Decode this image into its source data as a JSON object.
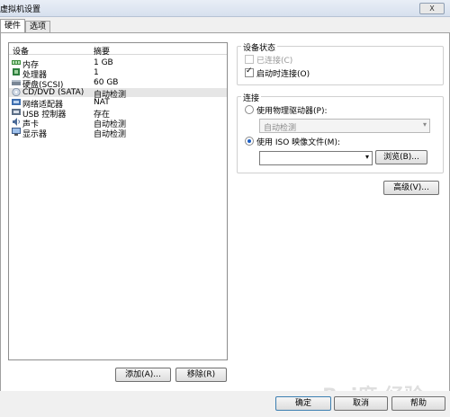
{
  "window": {
    "title": "虚拟机设置",
    "close_label": "X"
  },
  "tabs": [
    {
      "label": "硬件"
    },
    {
      "label": "选项"
    }
  ],
  "device_table": {
    "headers": {
      "device": "设备",
      "summary": "摘要"
    },
    "rows": [
      {
        "name": "内存",
        "summary": "1 GB",
        "icon": "memory-icon"
      },
      {
        "name": "处理器",
        "summary": "1",
        "icon": "cpu-icon"
      },
      {
        "name": "硬盘(SCSI)",
        "summary": "60 GB",
        "icon": "harddisk-icon"
      },
      {
        "name": "CD/DVD (SATA)",
        "summary": "自动检测",
        "icon": "cdrom-icon"
      },
      {
        "name": "网络适配器",
        "summary": "NAT",
        "icon": "network-icon"
      },
      {
        "name": "USB 控制器",
        "summary": "存在",
        "icon": "usb-icon"
      },
      {
        "name": "声卡",
        "summary": "自动检测",
        "icon": "sound-icon"
      },
      {
        "name": "显示器",
        "summary": "自动检测",
        "icon": "display-icon"
      }
    ],
    "selected_index": 3
  },
  "list_buttons": {
    "add": "添加(A)...",
    "remove": "移除(R)"
  },
  "device_status": {
    "title": "设备状态",
    "connected_label": "已连接(C)",
    "connected_checked": false,
    "connect_at_power_on_label": "启动时连接(O)",
    "connect_at_power_on_checked": true
  },
  "connection": {
    "title": "连接",
    "physical_drive_label": "使用物理驱动器(P):",
    "physical_drive_value": "自动检测",
    "iso_label": "使用 ISO 映像文件(M):",
    "iso_value": "",
    "browse_label": "浏览(B)...",
    "selected": "iso"
  },
  "advanced_label": "高级(V)...",
  "footer": {
    "ok": "确定",
    "cancel": "取消",
    "help": "帮助"
  },
  "watermark": "Bai度 经验",
  "colors": {
    "accent": "#1b5ec4",
    "selection": "#e6e6e6"
  }
}
